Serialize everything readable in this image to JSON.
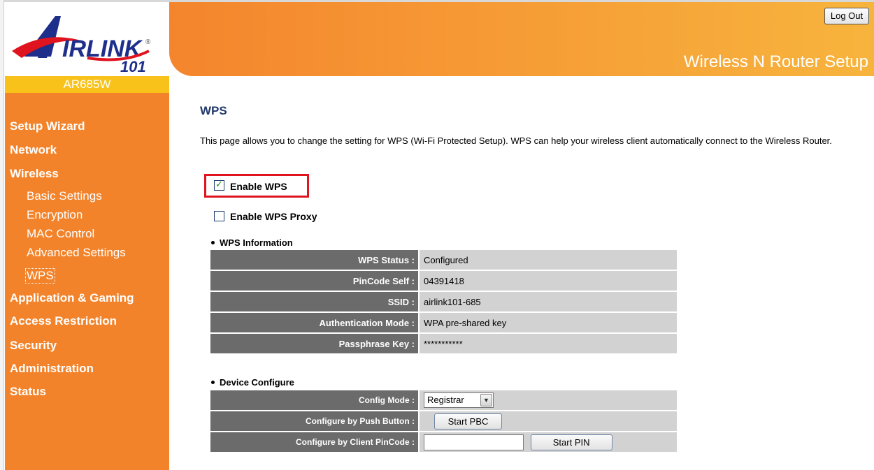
{
  "brand": {
    "logo_text": "AIRLINK 101",
    "model": "AR685W",
    "header_title": "Wireless N Router Setup",
    "logout_label": "Log Out",
    "colors": {
      "sidebar": "#f3832a",
      "model_bar": "#f8c21a",
      "title": "#21386b",
      "highlight": "#e0141e"
    }
  },
  "sidebar": {
    "setup_wizard": "Setup Wizard",
    "network": "Network",
    "wireless": "Wireless",
    "wireless_sub": [
      "Basic Settings",
      "Encryption",
      "MAC Control",
      "Advanced Settings",
      "WPS"
    ],
    "application_gaming": "Application & Gaming",
    "access_restriction": "Access Restriction",
    "security": "Security",
    "administration": "Administration",
    "status": "Status"
  },
  "main": {
    "title": "WPS",
    "description": "This page allows you to change the setting for WPS (Wi-Fi Protected Setup). WPS can help your wireless client automatically connect to the Wireless Router.",
    "enable_wps": {
      "label": "Enable WPS",
      "checked": true
    },
    "enable_wps_proxy": {
      "label": "Enable WPS Proxy",
      "checked": false
    },
    "wps_info": {
      "heading": "WPS Information",
      "rows": [
        {
          "label": "WPS Status :",
          "value": "Configured"
        },
        {
          "label": "PinCode Self :",
          "value": "04391418"
        },
        {
          "label": "SSID :",
          "value": "airlink101-685"
        },
        {
          "label": "Authentication Mode :",
          "value": "WPA pre-shared key"
        },
        {
          "label": "Passphrase Key :",
          "value": "***********"
        }
      ]
    },
    "device_config": {
      "heading": "Device Configure",
      "config_mode_label": "Config Mode :",
      "config_mode_value": "Registrar",
      "push_button_label": "Configure by Push Button :",
      "start_pbc": "Start PBC",
      "client_pin_label": "Configure by Client PinCode :",
      "client_pin_value": "",
      "start_pin": "Start PIN"
    }
  }
}
